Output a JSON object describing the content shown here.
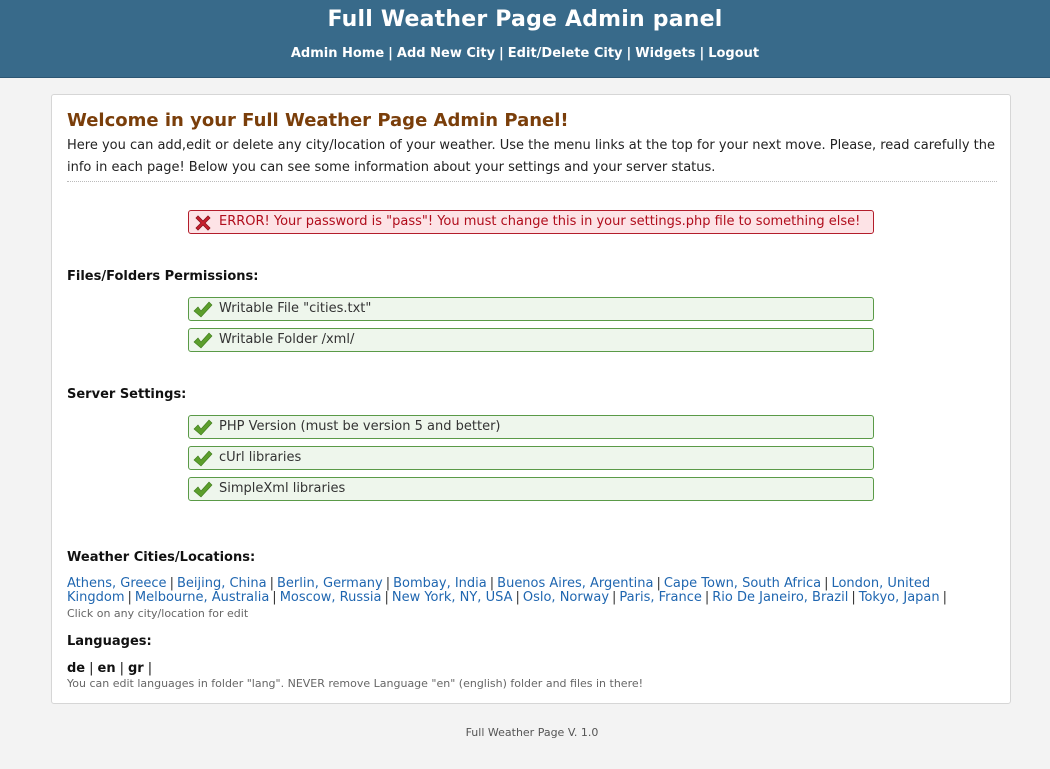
{
  "header": {
    "title": "Full Weather Page Admin panel",
    "nav": [
      "Admin Home",
      "Add New City",
      "Edit/Delete City",
      "Widgets",
      "Logout"
    ],
    "separator": "|"
  },
  "main": {
    "welcome_title": "Welcome in your Full Weather Page Admin Panel!",
    "intro": "Here you can add,edit or delete any city/location of your weather. Use the menu links at the top for your next move. Please, read carefully the info in each page! Below you can see some information about your settings and your server status.",
    "error_message": "ERROR! Your password is \"pass\"! You must change this in your settings.php file to something else!",
    "permissions": {
      "heading": "Files/Folders Permissions:",
      "items": [
        "Writable File \"cities.txt\"",
        "Writable Folder /xml/"
      ]
    },
    "server": {
      "heading": "Server Settings:",
      "items": [
        "PHP Version (must be version 5 and better)",
        "cUrl libraries",
        "SimpleXml libraries"
      ]
    },
    "cities": {
      "heading": "Weather Cities/Locations:",
      "items": [
        "Athens, Greece",
        "Beijing, China",
        "Berlin, Germany",
        "Bombay, India",
        "Buenos Aires, Argentina",
        "Cape Town, South Africa",
        "London, United Kingdom",
        "Melbourne, Australia",
        "Moscow, Russia",
        "New York, NY, USA",
        "Oslo, Norway",
        "Paris, France",
        "Rio De Janeiro, Brazil",
        "Tokyo, Japan"
      ],
      "hint": "Click on any city/location for edit"
    },
    "languages": {
      "heading": "Languages:",
      "items": [
        "de",
        "en",
        "gr"
      ],
      "hint": "You can edit languages in folder \"lang\". NEVER remove Language \"en\" (english) folder and files in there!"
    }
  },
  "footer": {
    "text": "Full Weather Page V. 1.0"
  },
  "colors": {
    "header_bg": "#386a8a",
    "title_brown": "#7a3e0a",
    "error_red": "#b00d1c",
    "ok_green": "#5a9a47",
    "link_blue": "#1f66b0"
  },
  "icons": {
    "error": "red-x-icon",
    "ok": "green-check-icon"
  }
}
